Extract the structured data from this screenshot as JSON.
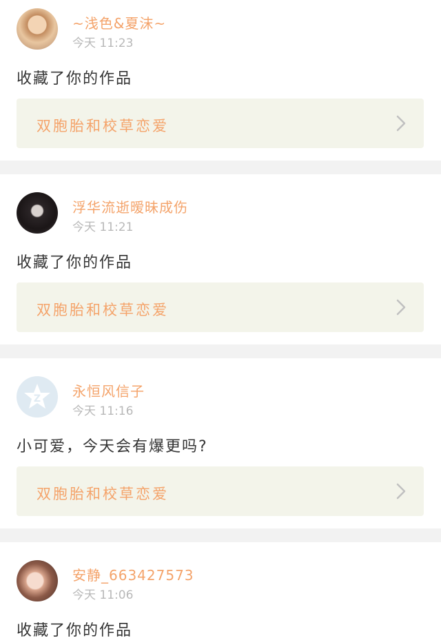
{
  "notifications": [
    {
      "username": "~浅色&夏沫~",
      "time": "今天 11:23",
      "message": "收藏了你的作品",
      "work_title": "双胞胎和校草恋爱",
      "avatar_icon": "user-photo-icon"
    },
    {
      "username": "浮华流逝暧昧成伤",
      "time": "今天 11:21",
      "message": "收藏了你的作品",
      "work_title": "双胞胎和校草恋爱",
      "avatar_icon": "user-photo-icon"
    },
    {
      "username": "永恒风信子",
      "time": "今天 11:16",
      "message": "小可爱，今天会有爆更吗?",
      "work_title": "双胞胎和校草恋爱",
      "avatar_icon": "qq-default-avatar-icon"
    },
    {
      "username": "安静_663427573",
      "time": "今天 11:06",
      "message": "收藏了你的作品",
      "avatar_icon": "user-photo-icon"
    }
  ],
  "colors": {
    "accent": "#f4a36a",
    "time_text": "#b8b8b8",
    "message_text": "#333333",
    "link_background": "#f3f4ea",
    "page_background": "#f2f2f2",
    "chevron": "#c0c0c0"
  }
}
